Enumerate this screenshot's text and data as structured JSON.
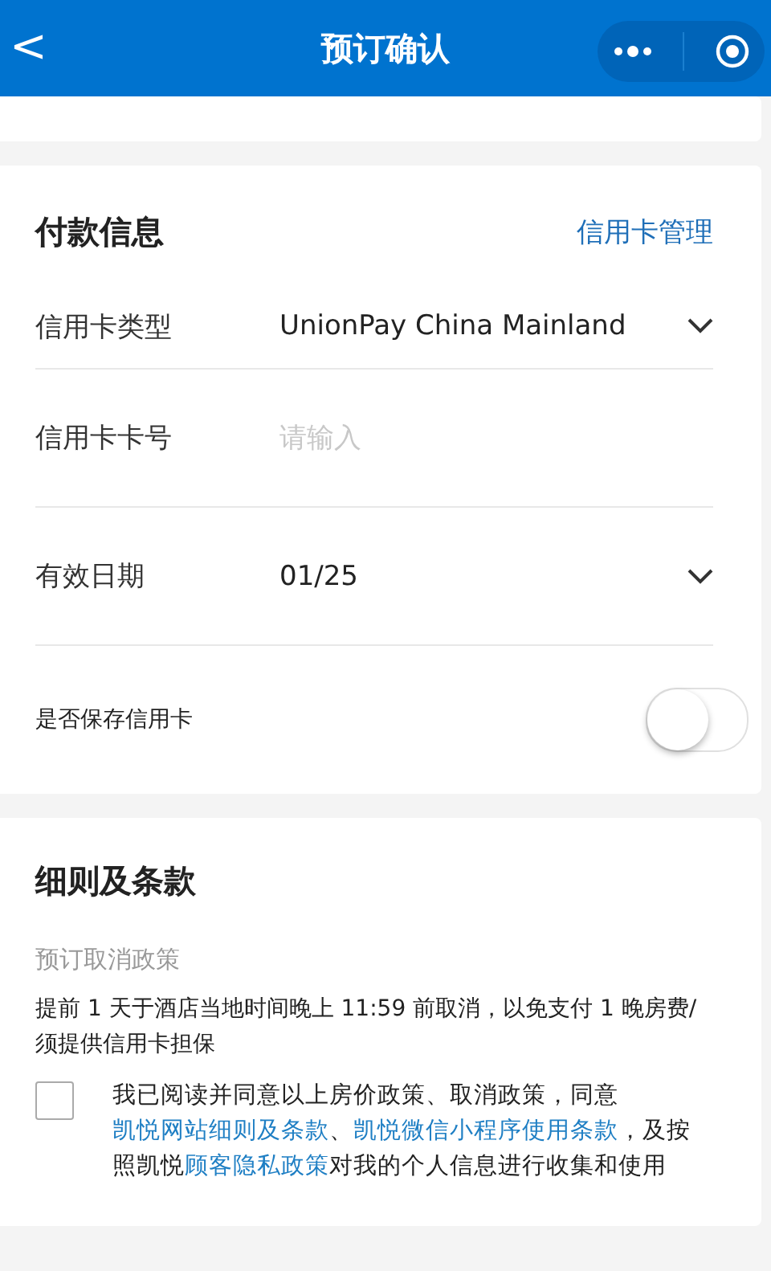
{
  "nav_bar": {
    "back": "<",
    "title": "预订确认"
  },
  "payment": {
    "title": "付款信息",
    "manage_link": "信用卡管理",
    "fields": [
      {
        "kind": "select",
        "label": "信用卡类型",
        "value": "UnionPay China Mainland"
      },
      {
        "kind": "input",
        "label": "信用卡卡号",
        "placeholder": "请输入"
      },
      {
        "kind": "select",
        "label": "有效日期",
        "value": "01/25"
      }
    ],
    "save_card": {
      "label": "是否保存信用卡",
      "on": false
    }
  },
  "terms": {
    "title": "细则及条款",
    "policy_label": "预订取消政策",
    "policy_text": "提前 1 天于酒店当地时间晚上 11:59 前取消，以免支付 1 晚房费/须提供信用卡担保",
    "agreement": {
      "checked": false,
      "segments": [
        {
          "kind": "text",
          "text": "我已阅读并同意以上房价政策、取消政策，同意"
        },
        {
          "kind": "link",
          "text": "凯悦网站细则及条款"
        },
        {
          "kind": "text",
          "text": "、"
        },
        {
          "kind": "link",
          "text": "凯悦微信小程序使用条款"
        },
        {
          "kind": "text",
          "text": "，及按照凯悦"
        },
        {
          "kind": "link",
          "text": "顾客隐私政策"
        },
        {
          "kind": "text",
          "text": "对我的个人信息进行收集和使用"
        }
      ]
    }
  }
}
